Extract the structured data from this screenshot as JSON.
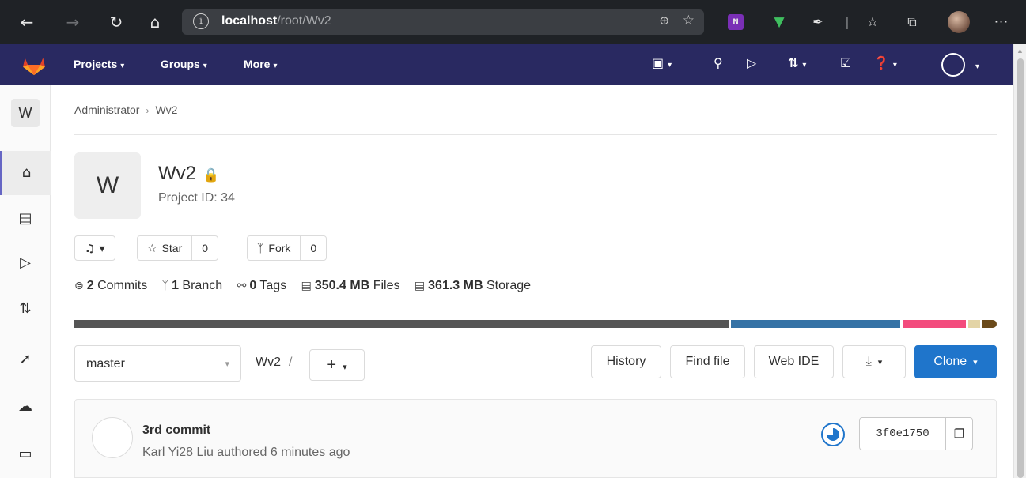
{
  "browser": {
    "back_icon": "←",
    "forward_icon": "→",
    "reload_icon": "↻",
    "home_icon": "⌂",
    "url_host": "localhost",
    "url_path": "/root/Wv2",
    "onenote_label": "N"
  },
  "nav": {
    "projects": "Projects",
    "groups": "Groups",
    "more": "More",
    "caret": "▾"
  },
  "sidebar": {
    "avatar_letter": "W"
  },
  "breadcrumb": {
    "parent": "Administrator",
    "separator": "›",
    "current": "Wv2"
  },
  "project": {
    "avatar_letter": "W",
    "name": "Wv2",
    "id_label": "Project ID: 34"
  },
  "actions": {
    "star_label": "Star",
    "star_count": "0",
    "fork_label": "Fork",
    "fork_count": "0"
  },
  "stats": {
    "commits_count": "2",
    "commits_label": "Commits",
    "branch_count": "1",
    "branch_label": "Branch",
    "tags_count": "0",
    "tags_label": "Tags",
    "files_size": "350.4 MB",
    "files_label": "Files",
    "storage_size": "361.3 MB",
    "storage_label": "Storage"
  },
  "language_bar": [
    {
      "share": 71.7,
      "color": "#555555"
    },
    {
      "share": 18.5,
      "color": "#3572a5"
    },
    {
      "share": 6.9,
      "color": "#f34b7d"
    },
    {
      "share": 1.3,
      "color": "#e3d4a6"
    },
    {
      "share": 1.6,
      "color": "#6b4a1a"
    }
  ],
  "repo": {
    "branch": "master",
    "path": "Wv2",
    "path_sep": "/",
    "add_label": "+"
  },
  "toolbar": {
    "history": "History",
    "find_file": "Find file",
    "web_ide": "Web IDE",
    "download_icon": "⤓",
    "clone": "Clone"
  },
  "commit": {
    "title": "3rd commit",
    "meta": "Karl Yi28 Liu authored 6 minutes ago",
    "sha": "3f0e1750"
  },
  "colors": {
    "nav_bg": "#292961",
    "clone_blue": "#1f75cb",
    "active_indicator": "#6666c4"
  }
}
